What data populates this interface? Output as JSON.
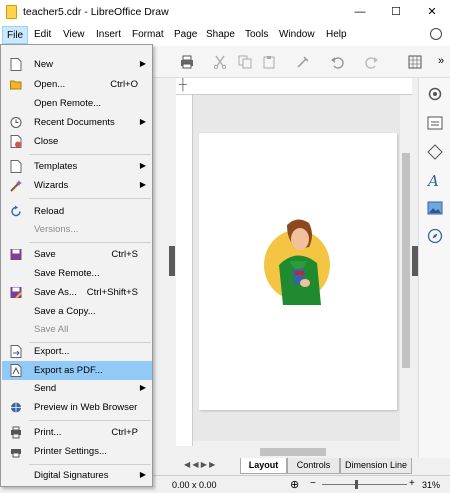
{
  "window": {
    "title": "teacher5.cdr - LibreOffice Draw",
    "minimize": "—",
    "maximize": "☐",
    "close": "✕"
  },
  "menubar": [
    "File",
    "Edit",
    "View",
    "Insert",
    "Format",
    "Page",
    "Shape",
    "Tools",
    "Window",
    "Help"
  ],
  "file_menu": {
    "new": "New",
    "open": "Open...",
    "open_sc": "Ctrl+O",
    "open_remote": "Open Remote...",
    "recent": "Recent Documents",
    "close": "Close",
    "templates": "Templates",
    "wizards": "Wizards",
    "reload": "Reload",
    "versions": "Versions...",
    "save": "Save",
    "save_sc": "Ctrl+S",
    "save_remote": "Save Remote...",
    "save_as": "Save As...",
    "save_as_sc": "Ctrl+Shift+S",
    "save_copy": "Save a Copy...",
    "save_all": "Save All",
    "export": "Export...",
    "export_pdf": "Export as PDF...",
    "send": "Send",
    "preview_web": "Preview in Web Browser",
    "print": "Print...",
    "print_sc": "Ctrl+P",
    "printer_settings": "Printer Settings...",
    "digital_signatures": "Digital Signatures"
  },
  "tabs": [
    "Layout",
    "Controls",
    "Dimension Line"
  ],
  "status": {
    "coords": "0.00 x 0.00",
    "zoom": "31%"
  },
  "toolbar": {
    "more": "»"
  },
  "colors": {
    "highlight": "#91c9f7",
    "menubar_active": "#cce8ff"
  }
}
